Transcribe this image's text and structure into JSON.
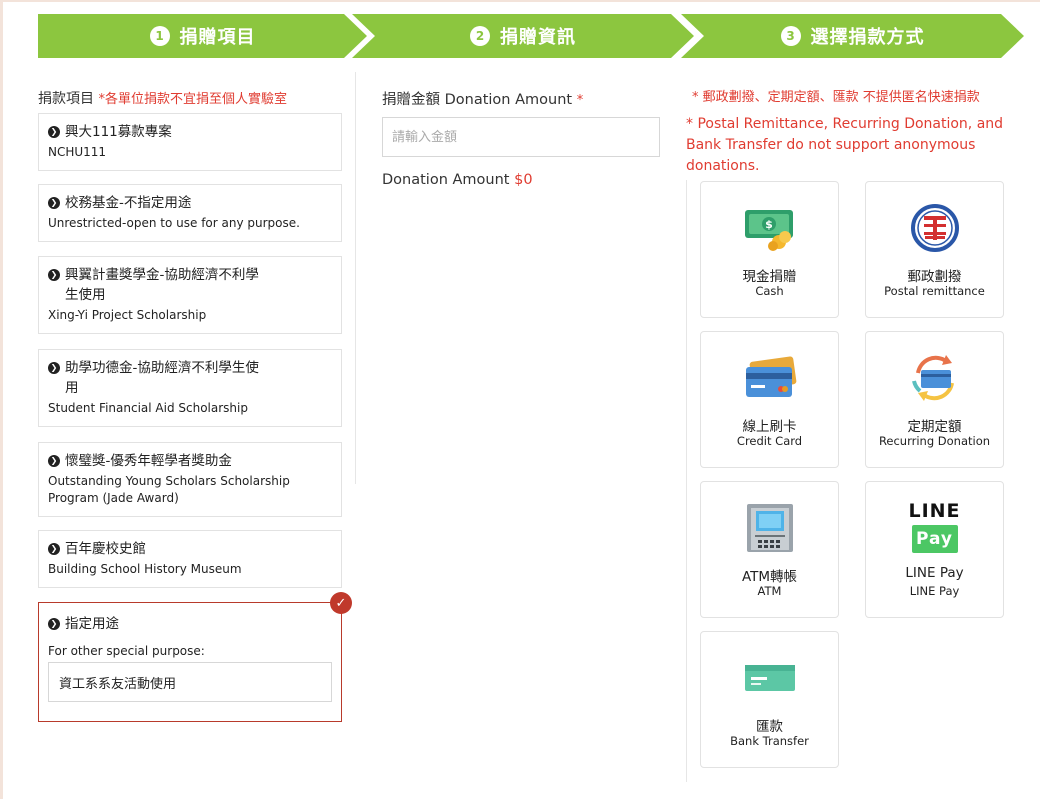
{
  "steps": [
    {
      "num": "1",
      "label": "捐贈項目"
    },
    {
      "num": "2",
      "label": "捐贈資訊"
    },
    {
      "num": "3",
      "label": "選擇捐款方式"
    }
  ],
  "left": {
    "label": "捐款項目",
    "required_note": "*各單位捐款不宜捐至個人實驗室",
    "items": [
      {
        "zh": "興大111募款專案",
        "en": "NCHU111"
      },
      {
        "zh": "校務基金-不指定用途",
        "en": "Unrestricted-open to use for any purpose."
      },
      {
        "zh": "興翼計畫獎學金-協助經濟不利學生使用",
        "en": "Xing-Yi Project Scholarship"
      },
      {
        "zh": "助學功德金-協助經濟不利學生使用",
        "en": "Student Financial Aid Scholarship"
      },
      {
        "zh": "懷璧獎-優秀年輕學者獎助金",
        "en": "Outstanding Young Scholars Scholarship Program (Jade Award)"
      },
      {
        "zh": "百年慶校史館",
        "en": "Building School History Museum"
      }
    ],
    "selected": {
      "zh": "指定用途",
      "purpose_label": "For other special purpose:",
      "purpose_value": "資工系系友活動使用"
    }
  },
  "middle": {
    "amount_label": "捐贈金額 Donation Amount",
    "required_mark": "*",
    "amount_placeholder": "請輸入金額",
    "amount_summary_label": "Donation Amount",
    "amount_summary_value": "$0"
  },
  "right": {
    "note_zh": "* 郵政劃撥、定期定額、匯款 不提供匿名快速捐款",
    "note_en": " * Postal Remittance, Recurring Donation, and Bank Transfer do not support anonymous donations.",
    "methods": [
      {
        "zh": "現金捐贈",
        "en": "Cash",
        "icon": "cash-icon"
      },
      {
        "zh": "郵政劃撥",
        "en": "Postal remittance",
        "icon": "post-office-icon"
      },
      {
        "zh": "線上刷卡",
        "en": "Credit Card",
        "icon": "credit-card-icon"
      },
      {
        "zh": "定期定額",
        "en": "Recurring Donation",
        "icon": "recurring-card-icon"
      },
      {
        "zh": "ATM轉帳",
        "en": "ATM",
        "icon": "atm-icon"
      },
      {
        "zh": "LINE Pay",
        "en": "LINE Pay",
        "icon": "line-pay-icon"
      },
      {
        "zh": "匯款",
        "en": "Bank Transfer",
        "icon": "bank-transfer-icon"
      }
    ],
    "line_pay_logo_top": "LINE",
    "line_pay_logo_bottom": "Pay"
  },
  "colors": {
    "accent_green": "#8cc63f",
    "required_red": "#e03c31",
    "selected_border": "#b83a2b"
  }
}
